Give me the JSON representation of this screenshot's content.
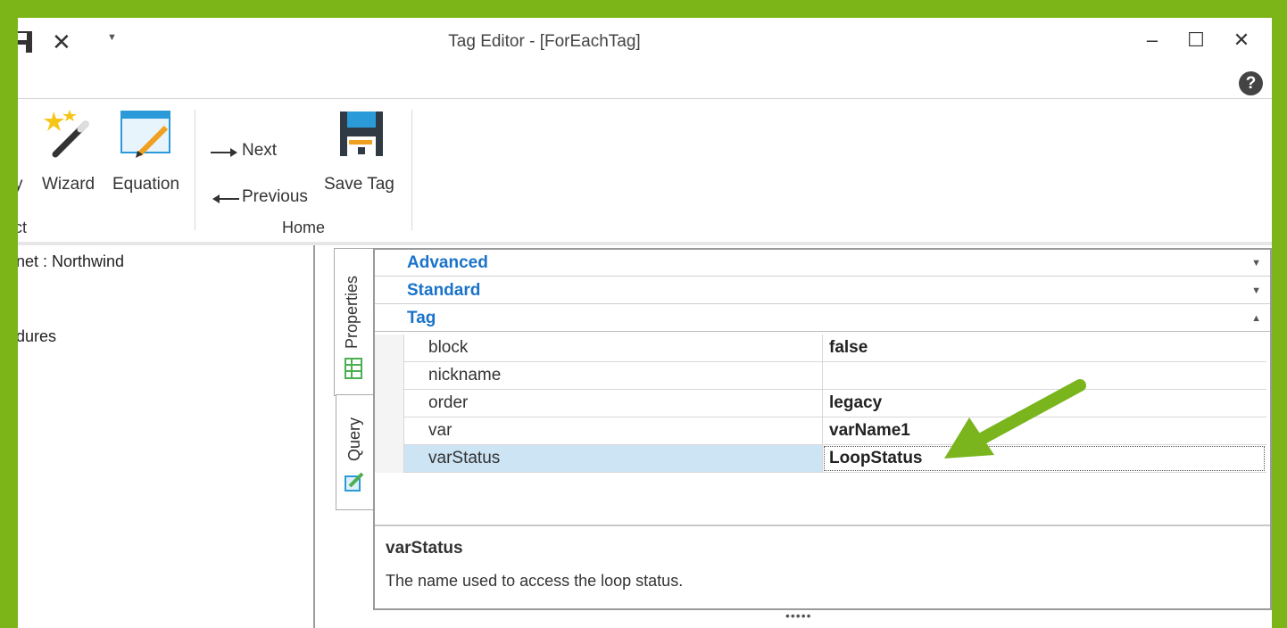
{
  "window": {
    "title": "Tag Editor - [ForEachTag]",
    "minimize": "–",
    "maximize": "☐",
    "close": "✕",
    "help": "?"
  },
  "quick_access": {
    "close": "✕",
    "dropdown": "▼"
  },
  "ribbon": {
    "partial_button": "y",
    "wizard": "Wizard",
    "equation": "Equation",
    "next": "Next",
    "previous": "Previous",
    "save_tag": "Save Tag",
    "group_left_partial": "ct",
    "group_home": "Home"
  },
  "left_panel": {
    "items": [
      "net : Northwind",
      "dures"
    ]
  },
  "side_tabs": {
    "properties": "Properties",
    "query": "Query"
  },
  "property_grid": {
    "categories": [
      {
        "label": "Advanced",
        "chevron": "▼"
      },
      {
        "label": "Standard",
        "chevron": "▼"
      },
      {
        "label": "Tag",
        "chevron": "▲"
      }
    ],
    "rows": [
      {
        "name": "block",
        "value": "false"
      },
      {
        "name": "nickname",
        "value": ""
      },
      {
        "name": "order",
        "value": "legacy"
      },
      {
        "name": "var",
        "value": "varName1"
      },
      {
        "name": "varStatus",
        "value": "LoopStatus"
      }
    ]
  },
  "description": {
    "title": "varStatus",
    "text": "The name used to access the loop status."
  },
  "splitter_grip": "•••••",
  "colors": {
    "accent_border": "#7cb518",
    "category_text": "#1a73c9",
    "selected_row": "#cde4f5",
    "arrow": "#7ab51d"
  }
}
